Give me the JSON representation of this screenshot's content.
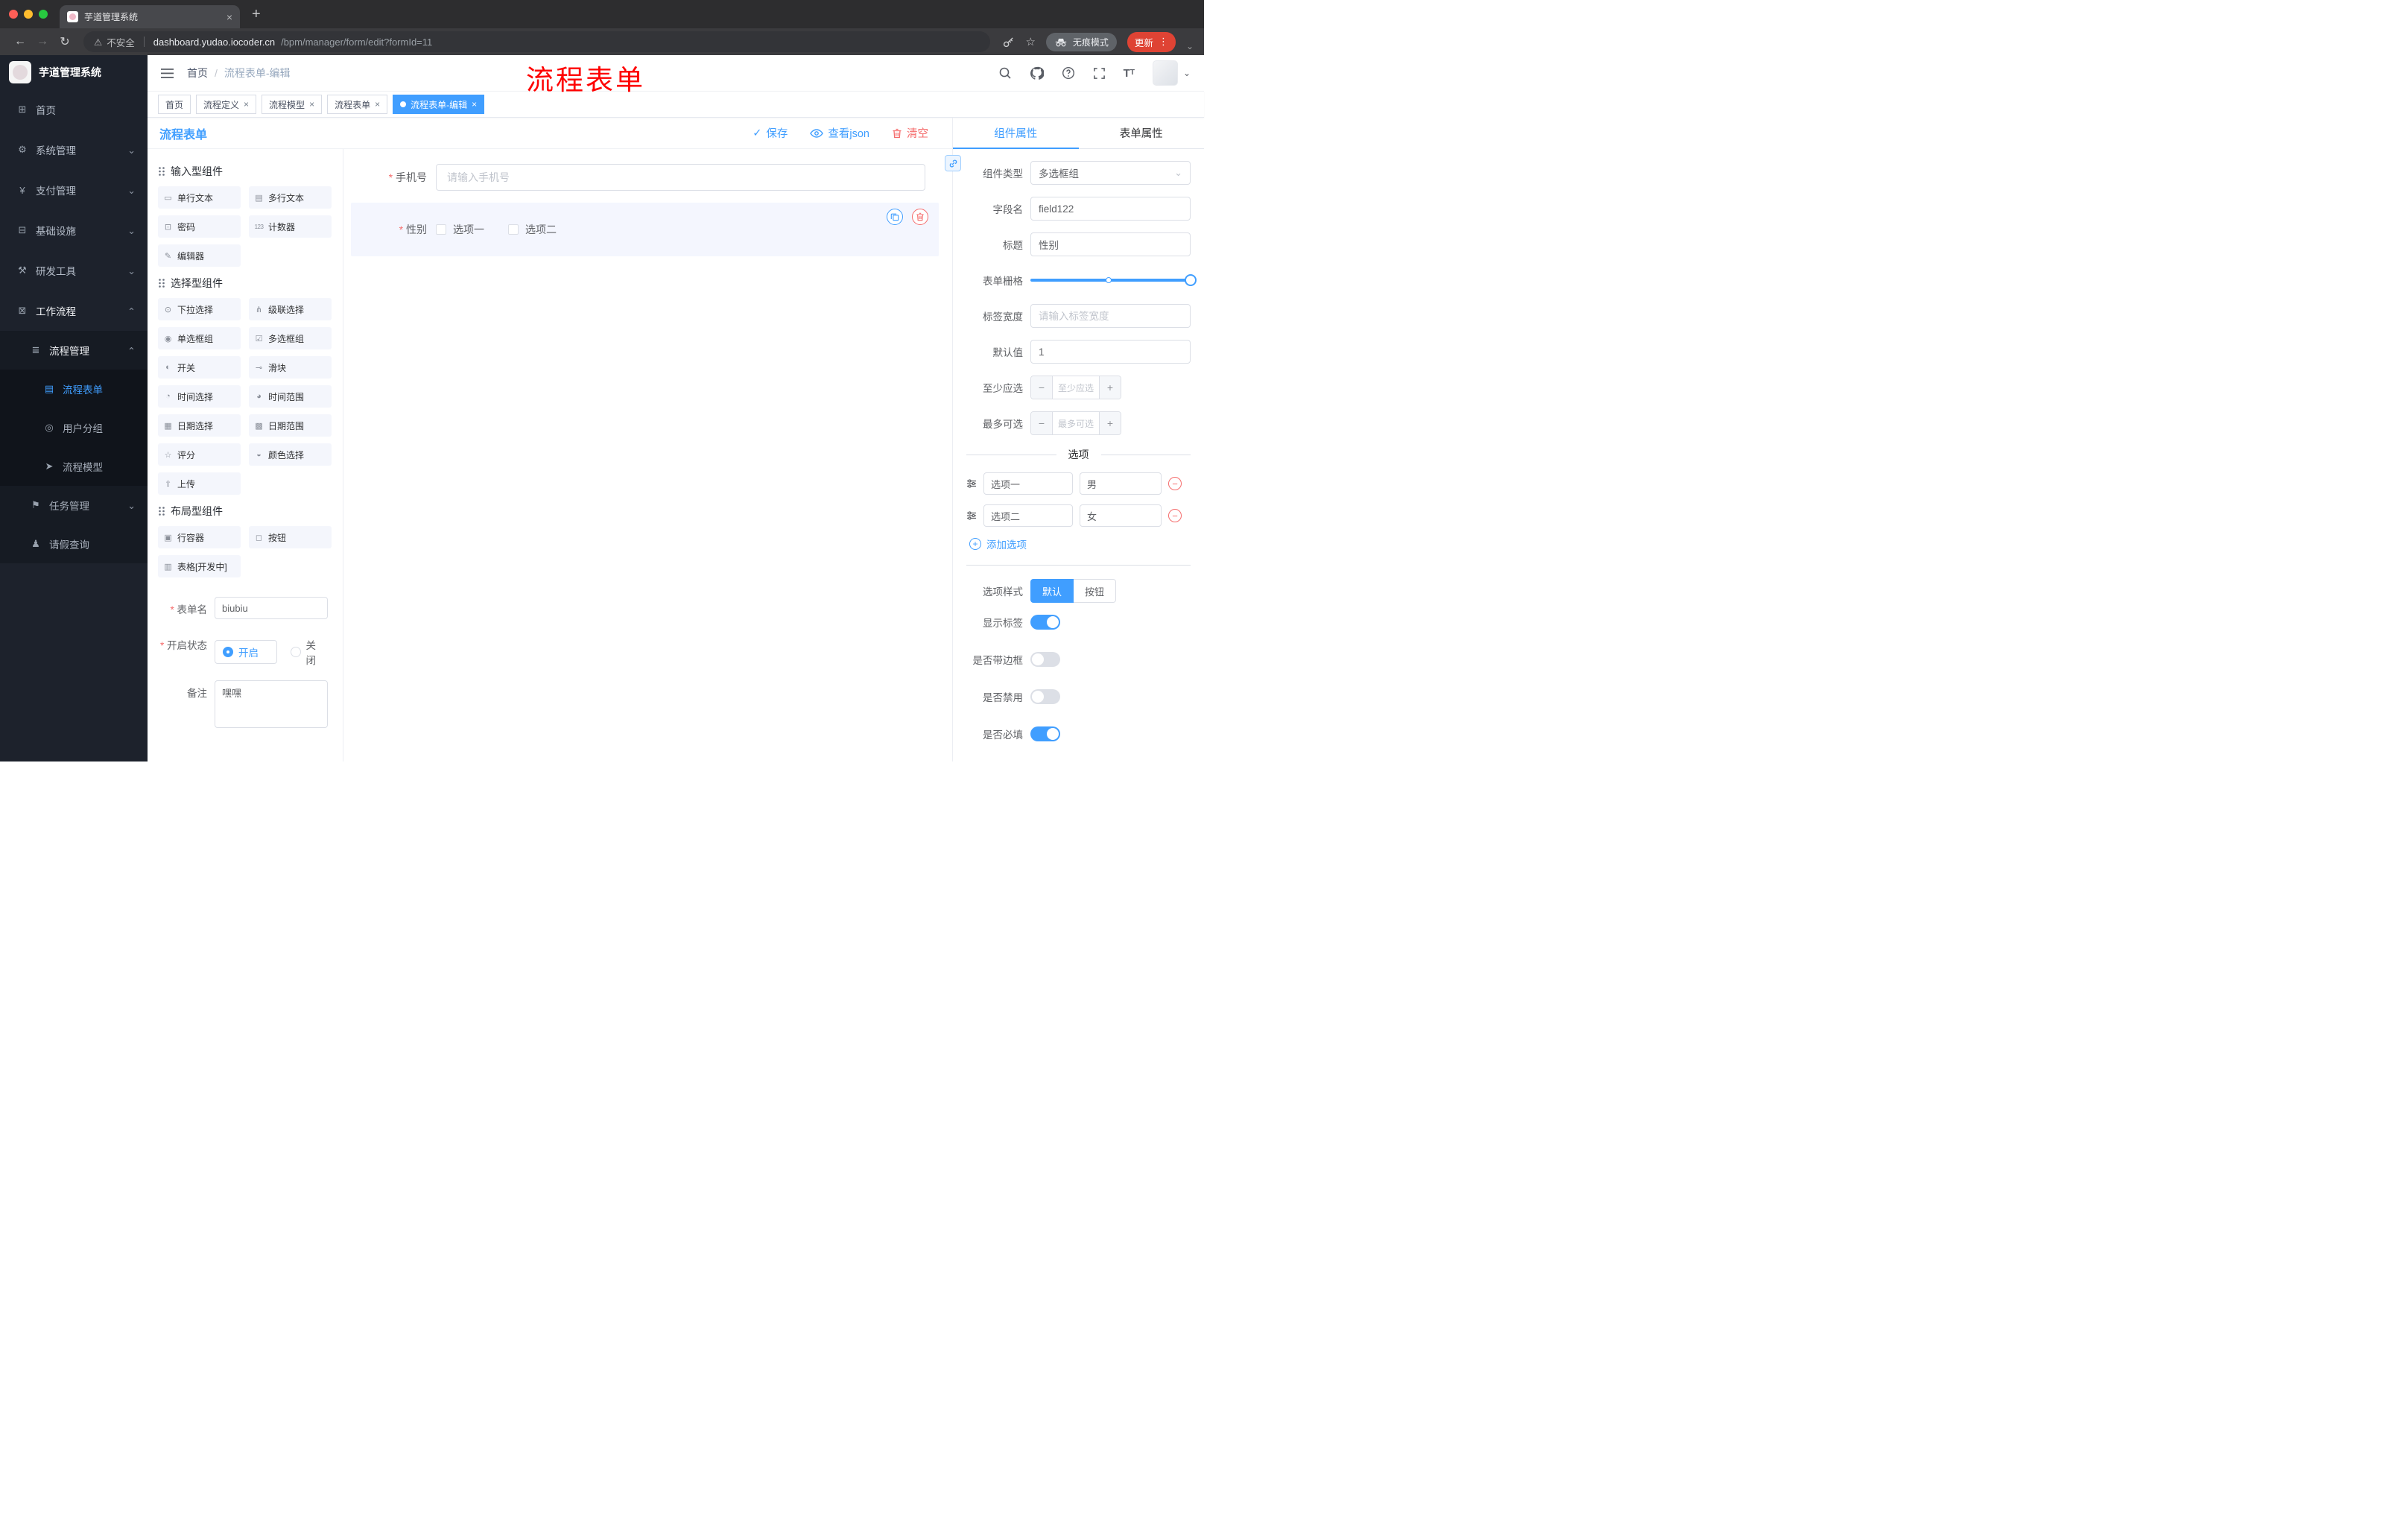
{
  "browser": {
    "tab_title": "芋道管理系统",
    "security": "不安全",
    "url_host": "dashboard.yudao.iocoder.cn",
    "url_path": "/bpm/manager/form/edit?formId=11",
    "incognito": "无痕模式",
    "update": "更新"
  },
  "annotation": {
    "text": "流程表单"
  },
  "colors": {
    "accent": "#409eff",
    "danger": "#f56c6c",
    "annotation": "#fe0000",
    "sidebar_bg": "#1d222c",
    "active_tag": "#409eff"
  },
  "sidebar": {
    "logo_title": "芋道管理系统",
    "items": [
      {
        "label": "首页",
        "icon": "⊞"
      },
      {
        "label": "系统管理",
        "icon": "⚙"
      },
      {
        "label": "支付管理",
        "icon": "¥"
      },
      {
        "label": "基础设施",
        "icon": "⊟"
      },
      {
        "label": "研发工具",
        "icon": "⚒"
      },
      {
        "label": "工作流程",
        "icon": "⊠"
      },
      {
        "label": "流程管理",
        "icon": "≣"
      },
      {
        "label": "流程表单",
        "icon": "▤"
      },
      {
        "label": "用户分组",
        "icon": "◎"
      },
      {
        "label": "流程模型",
        "icon": "➤"
      },
      {
        "label": "任务管理",
        "icon": "⚑"
      },
      {
        "label": "请假查询",
        "icon": "♟"
      }
    ]
  },
  "navbar": {
    "crumb_home": "首页",
    "crumb_sep": "/",
    "crumb_current": "流程表单-编辑"
  },
  "tags": [
    {
      "label": "首页"
    },
    {
      "label": "流程定义"
    },
    {
      "label": "流程模型"
    },
    {
      "label": "流程表单"
    },
    {
      "label": "流程表单-编辑"
    }
  ],
  "designer": {
    "title": "流程表单",
    "save": "保存",
    "view_json": "查看json",
    "clear": "清空"
  },
  "palette": {
    "sections": [
      {
        "title": "输入型组件",
        "items": [
          {
            "label": "单行文本",
            "icon": "▭"
          },
          {
            "label": "多行文本",
            "icon": "▤"
          },
          {
            "label": "密码",
            "icon": "⊡"
          },
          {
            "label": "计数器",
            "icon": "123"
          },
          {
            "label": "编辑器",
            "icon": "✎"
          }
        ]
      },
      {
        "title": "选择型组件",
        "items": [
          {
            "label": "下拉选择",
            "icon": "⊙"
          },
          {
            "label": "级联选择",
            "icon": "⋔"
          },
          {
            "label": "单选框组",
            "icon": "◉"
          },
          {
            "label": "多选框组",
            "icon": "☑"
          },
          {
            "label": "开关",
            "icon": "◐"
          },
          {
            "label": "滑块",
            "icon": "⊸"
          },
          {
            "label": "时间选择",
            "icon": "◔"
          },
          {
            "label": "时间范围",
            "icon": "◕"
          },
          {
            "label": "日期选择",
            "icon": "▦"
          },
          {
            "label": "日期范围",
            "icon": "▩"
          },
          {
            "label": "评分",
            "icon": "☆"
          },
          {
            "label": "颜色选择",
            "icon": "◒"
          },
          {
            "label": "上传",
            "icon": "⇧"
          }
        ]
      },
      {
        "title": "布局型组件",
        "items": [
          {
            "label": "行容器",
            "icon": "▣"
          },
          {
            "label": "按钮",
            "icon": "◻"
          },
          {
            "label": "表格[开发中]",
            "icon": "▥"
          }
        ]
      }
    ],
    "form": {
      "name_label": "表单名",
      "name_value": "biubiu",
      "status_label": "开启状态",
      "status_on": "开启",
      "status_off": "关闭",
      "remark_label": "备注",
      "remark_value": "嘿嘿"
    }
  },
  "canvas": {
    "phone_label": "手机号",
    "phone_placeholder": "请输入手机号",
    "gender_label": "性别",
    "gender_opt1": "选项一",
    "gender_opt2": "选项二"
  },
  "props": {
    "tab_component": "组件属性",
    "tab_form": "表单属性",
    "type_label": "组件类型",
    "type_value": "多选框组",
    "field_label": "字段名",
    "field_value": "field122",
    "title_label": "标题",
    "title_value": "性别",
    "grid_label": "表单栅格",
    "label_width_label": "标签宽度",
    "label_width_placeholder": "请输入标签宽度",
    "default_label": "默认值",
    "default_value": "1",
    "min_label": "至少应选",
    "min_placeholder": "至少应选",
    "max_label": "最多可选",
    "max_placeholder": "最多可选",
    "options_divider": "选项",
    "options": [
      {
        "label": "选项一",
        "value": "男"
      },
      {
        "label": "选项二",
        "value": "女"
      }
    ],
    "add_option": "添加选项",
    "style_label": "选项样式",
    "style_default": "默认",
    "style_button": "按钮",
    "switch_show_label": "显示标签",
    "switch_border": "是否带边框",
    "switch_disabled": "是否禁用",
    "switch_required": "是否必填"
  }
}
